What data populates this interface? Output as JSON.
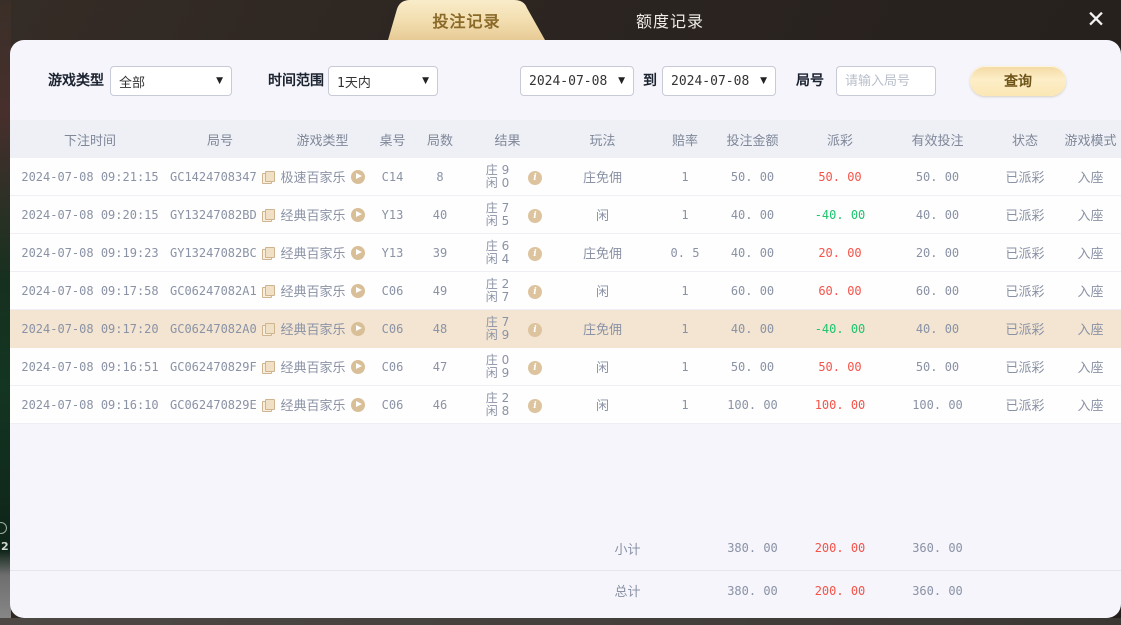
{
  "tabs": {
    "bet_records": "投注记录",
    "quota_records": "额度记录"
  },
  "close_icon": "✕",
  "background_peek": {
    "char": "2"
  },
  "filters": {
    "game_type_label": "游戏类型",
    "game_type_value": "全部",
    "time_range_label": "时间范围",
    "time_range_value": "1天内",
    "date_from": "2024-07-08",
    "to_label": "到",
    "date_to": "2024-07-08",
    "round_label": "局号",
    "round_placeholder": "请输入局号",
    "query_button": "查询",
    "caret": "▼"
  },
  "table": {
    "headers": {
      "time": "下注时间",
      "round": "局号",
      "game": "游戏类型",
      "table_no": "桌号",
      "rounds": "局数",
      "result": "结果",
      "play": "玩法",
      "odds": "赔率",
      "amount": "投注金额",
      "payout": "派彩",
      "valid": "有效投注",
      "status": "状态",
      "mode": "游戏模式"
    },
    "info_icon_glyph": "i",
    "rows": [
      {
        "time": "2024-07-08 09:21:15",
        "round": "GC1424708347",
        "game": "极速百家乐",
        "table_no": "C14",
        "rounds": "8",
        "result_line1": "庄 9",
        "result_line2": "闲 0",
        "play": "庄免佣",
        "odds": "1",
        "amount": "50. 00",
        "payout": "50. 00",
        "payout_color": "#f4544a",
        "valid": "50. 00",
        "status": "已派彩",
        "mode": "入座",
        "highlighted": false
      },
      {
        "time": "2024-07-08 09:20:15",
        "round": "GY13247082BD",
        "game": "经典百家乐",
        "table_no": "Y13",
        "rounds": "40",
        "result_line1": "庄 7",
        "result_line2": "闲 5",
        "play": "闲",
        "odds": "1",
        "amount": "40. 00",
        "payout": "-40. 00",
        "payout_color": "#1ec46e",
        "valid": "40. 00",
        "status": "已派彩",
        "mode": "入座",
        "highlighted": false
      },
      {
        "time": "2024-07-08 09:19:23",
        "round": "GY13247082BC",
        "game": "经典百家乐",
        "table_no": "Y13",
        "rounds": "39",
        "result_line1": "庄 6",
        "result_line2": "闲 4",
        "play": "庄免佣",
        "odds": "0. 5",
        "amount": "40. 00",
        "payout": "20. 00",
        "payout_color": "#f4544a",
        "valid": "20. 00",
        "status": "已派彩",
        "mode": "入座",
        "highlighted": false
      },
      {
        "time": "2024-07-08 09:17:58",
        "round": "GC06247082A1",
        "game": "经典百家乐",
        "table_no": "C06",
        "rounds": "49",
        "result_line1": "庄 2",
        "result_line2": "闲 7",
        "play": "闲",
        "odds": "1",
        "amount": "60. 00",
        "payout": "60. 00",
        "payout_color": "#f4544a",
        "valid": "60. 00",
        "status": "已派彩",
        "mode": "入座",
        "highlighted": false
      },
      {
        "time": "2024-07-08 09:17:20",
        "round": "GC06247082A0",
        "game": "经典百家乐",
        "table_no": "C06",
        "rounds": "48",
        "result_line1": "庄 7",
        "result_line2": "闲 9",
        "play": "庄免佣",
        "odds": "1",
        "amount": "40. 00",
        "payout": "-40. 00",
        "payout_color": "#1ec46e",
        "valid": "40. 00",
        "status": "已派彩",
        "mode": "入座",
        "highlighted": true
      },
      {
        "time": "2024-07-08 09:16:51",
        "round": "GC062470829F",
        "game": "经典百家乐",
        "table_no": "C06",
        "rounds": "47",
        "result_line1": "庄 0",
        "result_line2": "闲 9",
        "play": "闲",
        "odds": "1",
        "amount": "50. 00",
        "payout": "50. 00",
        "payout_color": "#f4544a",
        "valid": "50. 00",
        "status": "已派彩",
        "mode": "入座",
        "highlighted": false
      },
      {
        "time": "2024-07-08 09:16:10",
        "round": "GC062470829E",
        "game": "经典百家乐",
        "table_no": "C06",
        "rounds": "46",
        "result_line1": "庄 2",
        "result_line2": "闲 8",
        "play": "闲",
        "odds": "1",
        "amount": "100. 00",
        "payout": "100. 00",
        "payout_color": "#f4544a",
        "valid": "100. 00",
        "status": "已派彩",
        "mode": "入座",
        "highlighted": false
      }
    ],
    "subtotal": {
      "label": "小计",
      "amount": "380. 00",
      "payout": "200. 00",
      "payout_color": "#f4544a",
      "valid": "360. 00"
    },
    "total": {
      "label": "总计",
      "amount": "380. 00",
      "payout": "200. 00",
      "payout_color": "#f4544a",
      "valid": "360. 00"
    }
  },
  "colors": {
    "win": "#f4544a",
    "loss": "#1ec46e",
    "accent_gold": "#d9bf97",
    "highlight_row": "#f3e5d2"
  }
}
